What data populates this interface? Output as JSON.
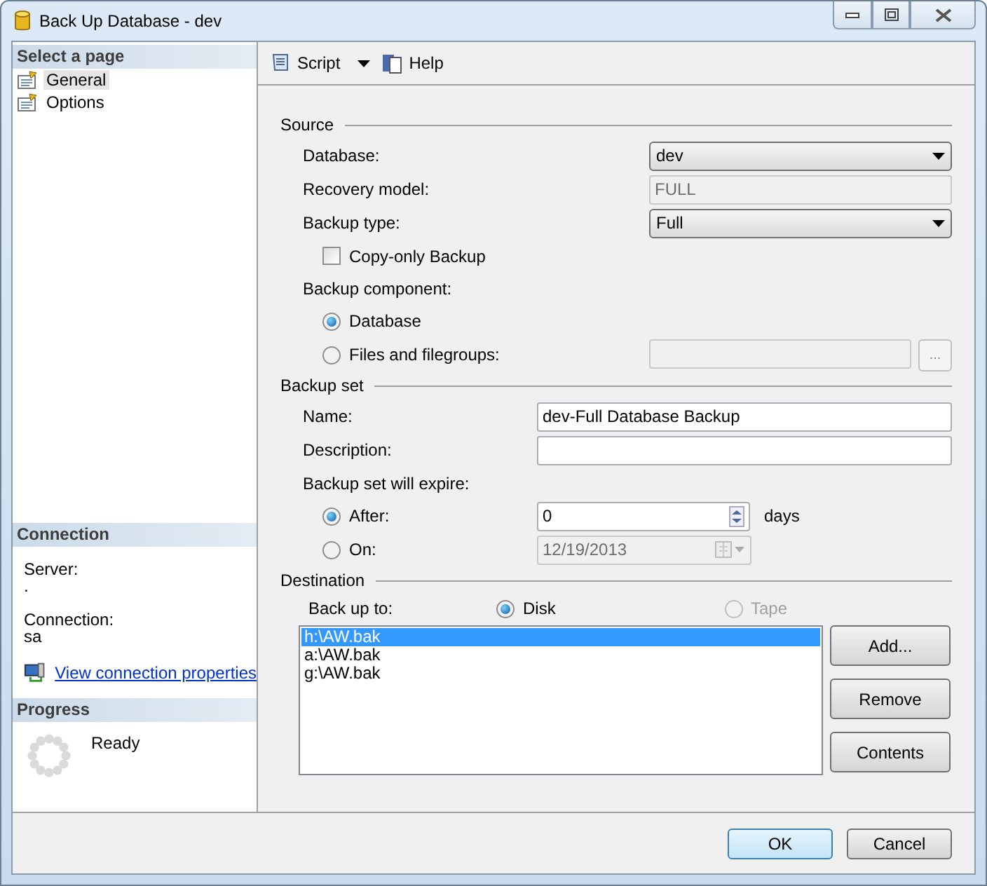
{
  "window": {
    "title": "Back Up Database - dev"
  },
  "sidebar": {
    "heading": "Select a page",
    "pages": [
      {
        "label": "General",
        "selected": true
      },
      {
        "label": "Options",
        "selected": false
      }
    ],
    "connection": {
      "heading": "Connection",
      "fields": [
        {
          "label": "Server:",
          "value": "."
        },
        {
          "label": "Connection:",
          "value": "sa"
        }
      ],
      "link": "View connection properties"
    },
    "progress": {
      "heading": "Progress",
      "status": "Ready"
    }
  },
  "toolbar": [
    {
      "label": "Script",
      "kind": "dropdown"
    },
    {
      "label": "Help",
      "kind": "button"
    }
  ],
  "source": {
    "heading": "Source",
    "database": {
      "label": "Database:",
      "value": "dev"
    },
    "recovery_model": {
      "label": "Recovery model:",
      "value": "FULL",
      "disabled": true
    },
    "backup_type": {
      "label": "Backup type:",
      "value": "Full"
    },
    "copy_only": {
      "label": "Copy-only Backup",
      "checked": false
    },
    "component_label": "Backup component:",
    "components": [
      {
        "label": "Database",
        "selected": true
      },
      {
        "label": "Files and filegroups:",
        "selected": false
      }
    ],
    "browse_button": "..."
  },
  "backup_set": {
    "heading": "Backup set",
    "name": {
      "label": "Name:",
      "value": "dev-Full Database Backup"
    },
    "description": {
      "label": "Description:"
    },
    "expire_label": "Backup set will expire:",
    "after": {
      "label": "After:",
      "selected": true,
      "value": "0",
      "unit": "days"
    },
    "on": {
      "label": "On:",
      "selected": false,
      "value": "12/19/2013"
    }
  },
  "destination": {
    "heading": "Destination",
    "label": "Back up to:",
    "media": [
      {
        "label": "Disk",
        "selected": true,
        "disabled": false
      },
      {
        "label": "Tape",
        "selected": false,
        "disabled": true
      }
    ],
    "files": [
      {
        "path": "h:\\AW.bak",
        "selected": true
      },
      {
        "path": "a:\\AW.bak",
        "selected": false
      },
      {
        "path": "g:\\AW.bak",
        "selected": false
      }
    ],
    "buttons": [
      "Add...",
      "Remove",
      "Contents"
    ]
  },
  "footer": {
    "buttons": [
      {
        "label": "OK",
        "default": true
      },
      {
        "label": "Cancel",
        "default": false
      }
    ]
  }
}
